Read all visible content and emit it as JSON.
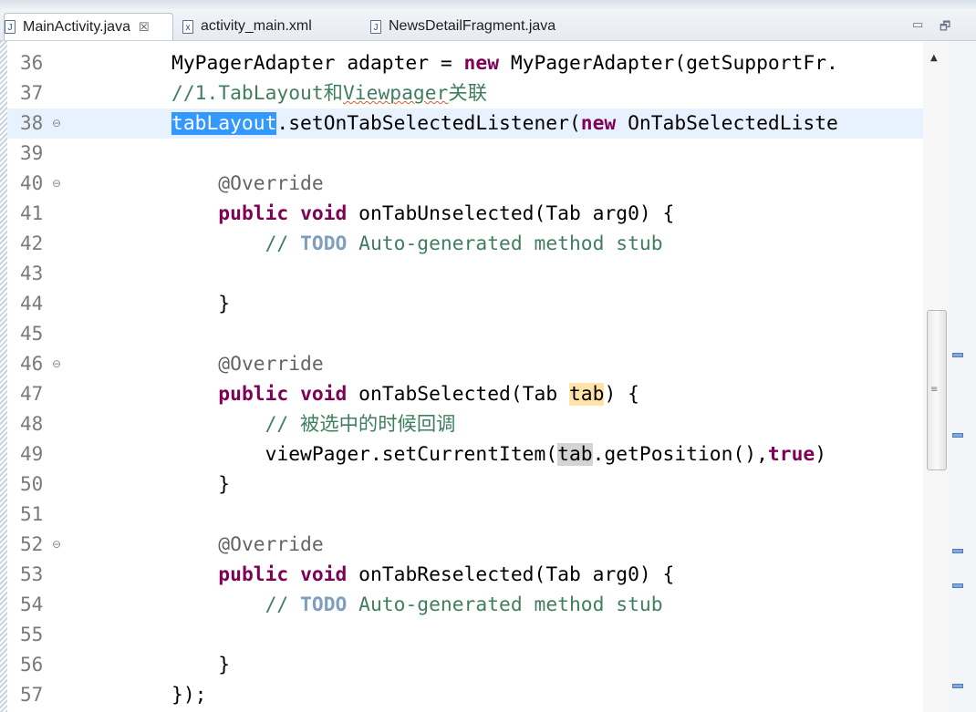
{
  "tabs": [
    {
      "label": "MainActivity.java",
      "active": true,
      "icon": "java-file-icon"
    },
    {
      "label": "activity_main.xml",
      "active": false,
      "icon": "xml-file-icon"
    },
    {
      "label": "NewsDetailFragment.java",
      "active": false,
      "icon": "java-file-icon"
    }
  ],
  "close_glyph": "☒",
  "window_buttons": {
    "minimize": "▭",
    "maximize": "🗗"
  },
  "lines": [
    {
      "n": "36",
      "fold": "",
      "html": "MyPagerAdapter adapter = <span class=\"kw\">new</span> MyPagerAdapter(getSupportFr."
    },
    {
      "n": "37",
      "fold": "",
      "html": "<span class=\"cm\">//1.TabLayout和<span class=\"squig\">Viewpager</span>关联</span>"
    },
    {
      "n": "38",
      "fold": "⊖",
      "hl": true,
      "html": "<span class=\"sel\">tabLayout</span>.setOnTabSelectedListener(<span class=\"kw\">new</span> OnTabSelectedListe"
    },
    {
      "n": "39",
      "fold": "",
      "html": ""
    },
    {
      "n": "40",
      "fold": "⊖",
      "html": "    <span class=\"ann\">@Override</span>"
    },
    {
      "n": "41",
      "fold": "",
      "html": "    <span class=\"kw\">public</span> <span class=\"kw\">void</span> onTabUnselected(Tab arg0) {"
    },
    {
      "n": "42",
      "fold": "",
      "html": "        <span class=\"cm\">// <span class=\"todo\">TODO</span> Auto-generated method stub</span>"
    },
    {
      "n": "43",
      "fold": "",
      "html": ""
    },
    {
      "n": "44",
      "fold": "",
      "html": "    }"
    },
    {
      "n": "45",
      "fold": "",
      "html": ""
    },
    {
      "n": "46",
      "fold": "⊖",
      "html": "    <span class=\"ann\">@Override</span>"
    },
    {
      "n": "47",
      "fold": "",
      "html": "    <span class=\"kw\">public</span> <span class=\"kw\">void</span> onTabSelected(Tab <span class=\"occ\">tab</span>) {"
    },
    {
      "n": "48",
      "fold": "",
      "html": "        <span class=\"cm\">// 被选中的时候回调</span>"
    },
    {
      "n": "49",
      "fold": "",
      "html": "        viewPager.setCurrentItem(<span class=\"occ2\">tab</span>.getPosition(),<span class=\"kw\">true</span>)"
    },
    {
      "n": "50",
      "fold": "",
      "html": "    }"
    },
    {
      "n": "51",
      "fold": "",
      "html": ""
    },
    {
      "n": "52",
      "fold": "⊖",
      "html": "    <span class=\"ann\">@Override</span>"
    },
    {
      "n": "53",
      "fold": "",
      "html": "    <span class=\"kw\">public</span> <span class=\"kw\">void</span> onTabReselected(Tab arg0) {"
    },
    {
      "n": "54",
      "fold": "",
      "html": "        <span class=\"cm\">// <span class=\"todo\">TODO</span> Auto-generated method stub</span>"
    },
    {
      "n": "55",
      "fold": "",
      "html": ""
    },
    {
      "n": "56",
      "fold": "",
      "html": "    }"
    },
    {
      "n": "57",
      "fold": "",
      "html": "});"
    }
  ],
  "colors": {
    "keyword": "#7f0055",
    "comment": "#3f7f5f",
    "annotation": "#646464",
    "selection": "#3399ff",
    "line_highlight": "#e8f2fe"
  }
}
